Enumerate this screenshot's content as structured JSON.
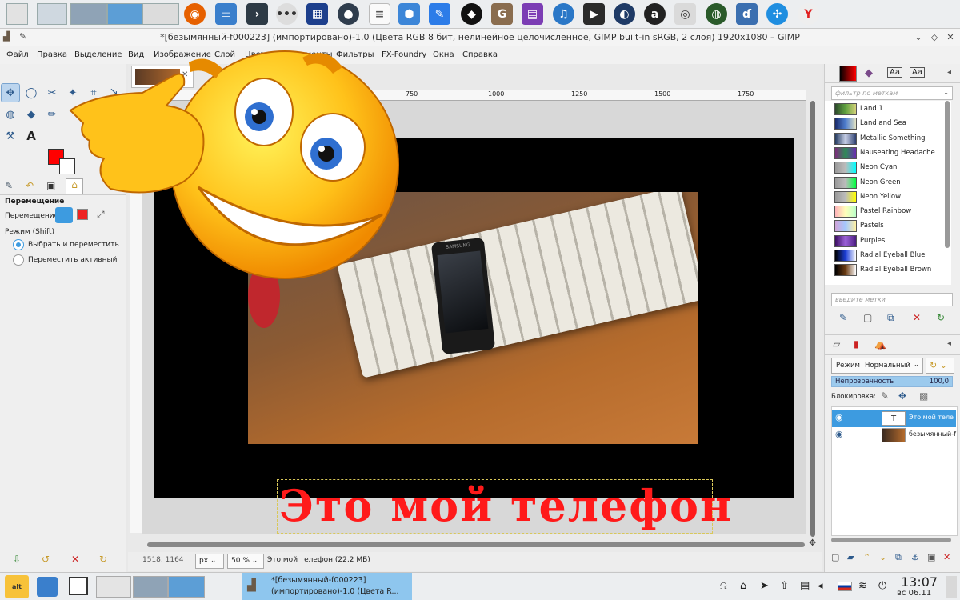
{
  "window": {
    "title": "*[безымянный-f000223] (импортировано)-1.0 (Цвета RGB 8 бит, нелинейное целочисленное, GIMP built-in sRGB, 2 слоя) 1920x1080 – GIMP"
  },
  "menu": [
    "Файл",
    "Правка",
    "Выделение",
    "Вид",
    "Изображение",
    "Слой",
    "Цвет",
    "Инструменты",
    "Фильтры",
    "FX-Foundry",
    "Окна",
    "Справка"
  ],
  "tool_options": {
    "title": "Перемещение",
    "move_label": "Перемещение:",
    "mode_label": "Режим (Shift)",
    "radio_pick": "Выбрать и переместить",
    "radio_active": "Переместить активный"
  },
  "ruler": {
    "top_ticks": [
      "750",
      "1000",
      "1250",
      "1500",
      "1750"
    ]
  },
  "canvas": {
    "overlay_text": "Это мой  телефон",
    "phone_brand": "SAMSUNG"
  },
  "status": {
    "coords": "1518, 1164",
    "unit": "px",
    "zoom": "50 %",
    "info": "Это мой  телефон (22,2 МБ)"
  },
  "gradients": {
    "filter_placeholder": "фильтр по меткам",
    "tag_placeholder": "введите метки",
    "items": [
      {
        "name": "Land 1",
        "colors": "#2c4a2c,#5fa13f,#d4d27a"
      },
      {
        "name": "Land and Sea",
        "colors": "#1a2b6b,#4f7fd0,#e4e4c4"
      },
      {
        "name": "Metallic Something",
        "colors": "#263c62,#c7cfe6,#2d3f70"
      },
      {
        "name": "Nauseating Headache",
        "colors": "#7c2d7c,#2e8b57,#6b2bb0"
      },
      {
        "name": "Neon Cyan",
        "colors": "#9a9a9a,#bcbcbc,#00ffff"
      },
      {
        "name": "Neon Green",
        "colors": "#9a9a9a,#bcbcbc,#00ff40"
      },
      {
        "name": "Neon Yellow",
        "colors": "#9a9a9a,#bcbcbc,#ffff00"
      },
      {
        "name": "Pastel Rainbow",
        "colors": "#ffb3ba,#ffffba,#baffc9"
      },
      {
        "name": "Pastels",
        "colors": "#cfa4d8,#a4c8ff,#fff1a4"
      },
      {
        "name": "Purples",
        "colors": "#3d0f63,#9c62d9,#4b1d80"
      },
      {
        "name": "Radial Eyeball Blue",
        "colors": "#000000,#1c3fd8,#ffffff"
      },
      {
        "name": "Radial Eyeball Brown",
        "colors": "#000000,#6b3b12,#ffffff"
      }
    ]
  },
  "layers": {
    "mode_label": "Режим",
    "mode_value": "Нормальный",
    "opacity_label": "Непрозрачность",
    "opacity_value": "100,0",
    "lock_label": "Блокировка:",
    "items": [
      {
        "name": "Это мой  теле",
        "selected": true
      },
      {
        "name": "безымянный-f",
        "selected": false
      }
    ]
  },
  "taskbar": {
    "task_title_line1": "*[безымянный-f000223]",
    "task_title_line2": "(импортировано)-1.0 (Цвета R...",
    "time": "13:07",
    "date": "вс 06.11"
  }
}
